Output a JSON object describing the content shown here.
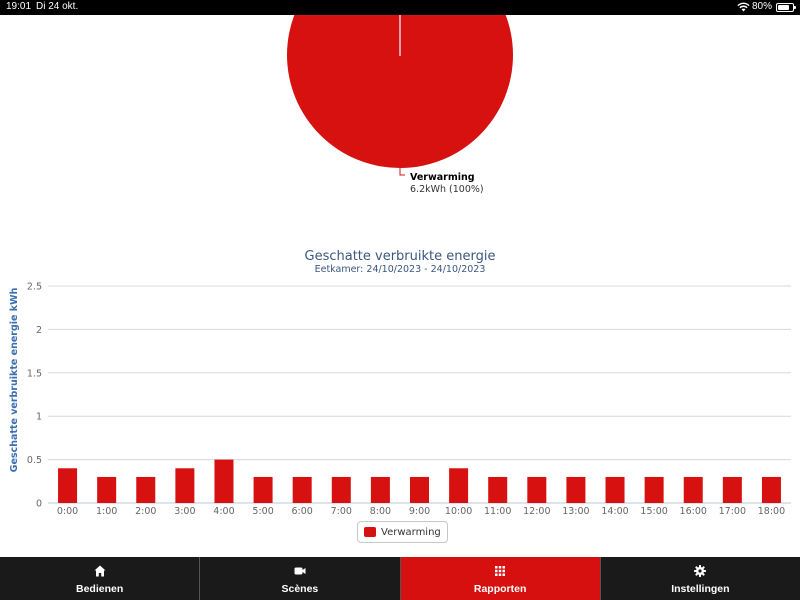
{
  "status_bar": {
    "time": "19:01",
    "date": "Di 24 okt.",
    "battery": "80%",
    "battery_level": 0.8
  },
  "pie_chart": {
    "slices": [
      {
        "name": "Verwarming",
        "value_label": "6.2kWh (100%)",
        "percent": 100,
        "color": "#d71010"
      }
    ]
  },
  "chart_data": {
    "type": "bar",
    "title": "Geschatte verbruikte energie",
    "subtitle": "Eetkamer: 24/10/2023 - 24/10/2023",
    "xlabel": "",
    "ylabel": "Geschatte verbruikte energie kWh",
    "ylim": [
      0,
      2.5
    ],
    "yticks": [
      "0",
      "0.5",
      "1",
      "1.5",
      "2",
      "2.5"
    ],
    "grid": true,
    "legend_placement": "bottom-center",
    "categories": [
      "0:00",
      "1:00",
      "2:00",
      "3:00",
      "4:00",
      "5:00",
      "6:00",
      "7:00",
      "8:00",
      "9:00",
      "10:00",
      "11:00",
      "12:00",
      "13:00",
      "14:00",
      "15:00",
      "16:00",
      "17:00",
      "18:00"
    ],
    "series": [
      {
        "name": "Verwarming",
        "color": "#d71010",
        "values": [
          0.4,
          0.3,
          0.3,
          0.4,
          0.5,
          0.3,
          0.3,
          0.3,
          0.3,
          0.3,
          0.4,
          0.3,
          0.3,
          0.3,
          0.3,
          0.3,
          0.3,
          0.3,
          0.3
        ]
      }
    ]
  },
  "tabbar": {
    "tabs": [
      {
        "label": "Bedienen",
        "icon": "home-icon",
        "active": false
      },
      {
        "label": "Scènes",
        "icon": "video-camera-icon",
        "active": false
      },
      {
        "label": "Rapporten",
        "icon": "grid-icon",
        "active": true
      },
      {
        "label": "Instellingen",
        "icon": "gear-icon",
        "active": false
      }
    ]
  }
}
